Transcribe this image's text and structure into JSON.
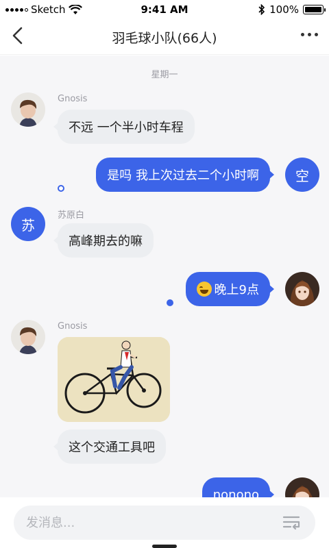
{
  "status_bar": {
    "carrier": "Sketch",
    "time": "9:41 AM",
    "battery": "100%"
  },
  "nav": {
    "title": "羽毛球小队(66人)"
  },
  "chat": {
    "day_divider": "星期一",
    "messages": [
      {
        "sender": "Gnosis",
        "text": "不远 一个半小时车程",
        "direction": "in"
      },
      {
        "sender": "空",
        "text": "是吗 我上次过去二个小时啊",
        "direction": "out",
        "avatar_letter": "空",
        "read": false
      },
      {
        "sender": "苏原白",
        "text": "高峰期去的嘛",
        "direction": "in",
        "avatar_letter": "苏"
      },
      {
        "sender": "me",
        "text": "晚上9点",
        "direction": "out",
        "emoji": "laughing-tears-emoji",
        "read": true
      },
      {
        "sender": "Gnosis",
        "type": "image",
        "image_subject": "bicycle-illustration",
        "direction": "in"
      },
      {
        "sender": "Gnosis",
        "text": "这个交通工具吧",
        "direction": "in"
      },
      {
        "sender": "me",
        "text": "nonono",
        "direction": "out"
      }
    ]
  },
  "input": {
    "placeholder": "发消息..."
  },
  "colors": {
    "accent": "#3c64e8",
    "incoming_bubble": "#eceef1",
    "chat_background": "#f6f6f8"
  }
}
